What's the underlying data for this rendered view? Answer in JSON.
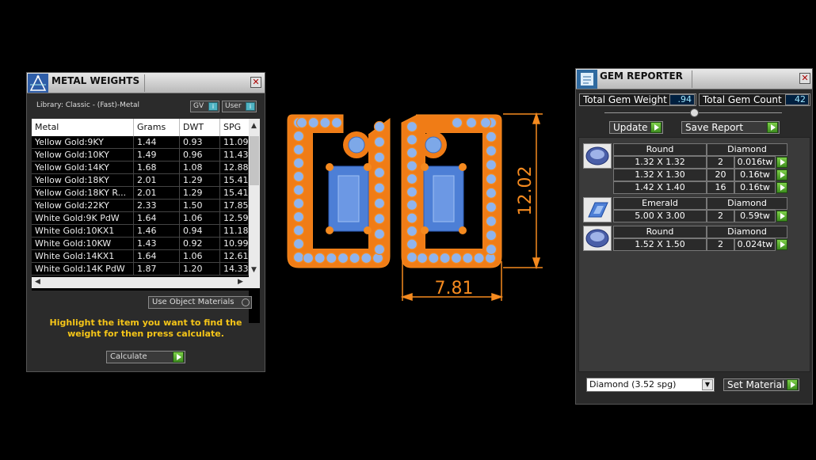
{
  "metal_weights": {
    "title": "METAL WEIGHTS",
    "library_label": "Library: Classic - (Fast)-Metal",
    "gv_toggle": "GV",
    "user_toggle": "User",
    "columns": [
      "Metal",
      "Grams",
      "DWT",
      "SPG"
    ],
    "rows": [
      [
        "Yellow Gold:9KY",
        "1.44",
        "0.93",
        "11.09"
      ],
      [
        "Yellow Gold:10KY",
        "1.49",
        "0.96",
        "11.43"
      ],
      [
        "Yellow Gold:14KY",
        "1.68",
        "1.08",
        "12.88"
      ],
      [
        "Yellow Gold:18KY",
        "2.01",
        "1.29",
        "15.41"
      ],
      [
        "Yellow Gold:18KY R...",
        "2.01",
        "1.29",
        "15.41"
      ],
      [
        "Yellow Gold:22KY",
        "2.33",
        "1.50",
        "17.85"
      ],
      [
        "White Gold:9K PdW",
        "1.64",
        "1.06",
        "12.59"
      ],
      [
        "White Gold:10KX1",
        "1.46",
        "0.94",
        "11.18"
      ],
      [
        "White Gold:10KW",
        "1.43",
        "0.92",
        "10.99"
      ],
      [
        "White Gold:14KX1",
        "1.64",
        "1.06",
        "12.61"
      ],
      [
        "White Gold:14K PdW",
        "1.87",
        "1.20",
        "14.33"
      ]
    ],
    "use_object_materials": "Use Object Materials",
    "instruction": "Highlight the item you want to find the weight for then press calculate.",
    "calculate_label": "Calculate"
  },
  "viewport": {
    "dimension_height": "12.02",
    "dimension_width": "7.81"
  },
  "gem_reporter": {
    "title": "GEM REPORTER",
    "total_weight_label": "Total Gem Weight",
    "total_weight_value": ".94",
    "total_count_label": "Total Gem Count",
    "total_count_value": "42",
    "update_label": "Update",
    "save_report_label": "Save Report",
    "groups": [
      {
        "shape": "Round",
        "material": "Diamond",
        "icon": "round-gem-icon",
        "rows": [
          {
            "size": "1.32 X 1.32",
            "count": "2",
            "weight": "0.016tw"
          },
          {
            "size": "1.32 X 1.30",
            "count": "20",
            "weight": "0.16tw"
          },
          {
            "size": "1.42 X 1.40",
            "count": "16",
            "weight": "0.16tw"
          }
        ]
      },
      {
        "shape": "Emerald",
        "material": "Diamond",
        "icon": "emerald-gem-icon",
        "rows": [
          {
            "size": "5.00 X 3.00",
            "count": "2",
            "weight": "0.59tw"
          }
        ]
      },
      {
        "shape": "Round",
        "material": "Diamond",
        "icon": "round-gem-icon",
        "rows": [
          {
            "size": "1.52 X 1.50",
            "count": "2",
            "weight": "0.024tw"
          }
        ]
      }
    ],
    "material_select": "Diamond     (3.52 spg)",
    "set_material_label": "Set Material"
  },
  "colors": {
    "metal_orange": "#f58a1f",
    "gem_blue": "#4d7fd6",
    "accent_green": "#5cb531",
    "instruction_yellow": "#f5c518"
  }
}
